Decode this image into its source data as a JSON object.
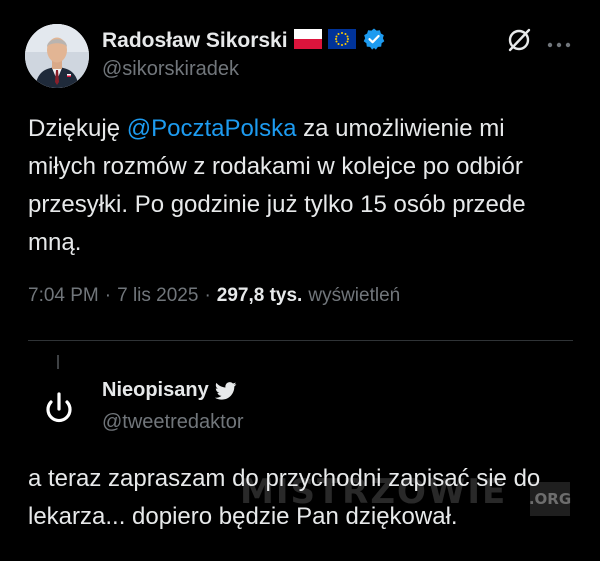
{
  "tweet": {
    "author": {
      "name": "Radosław Sikorski",
      "handle": "@sikorskiradek",
      "flags": [
        "poland-flag",
        "eu-flag"
      ],
      "verified": true
    },
    "text_before": "Dziękuję ",
    "mention": "@PocztaPolska",
    "text_after": " za umożliwienie mi miłych rozmów z rodakami w kolejce po odbiór przesyłki. Po godzinie już tylko 15 osób przede mną.",
    "time": "7:04 PM",
    "separator": "·",
    "date": "7 lis 2025",
    "views_count": "297,8 tys.",
    "views_label": "wyświetleń",
    "icons": {
      "grok": "grok-icon",
      "more": "more-options-icon"
    }
  },
  "reply": {
    "author": {
      "name": "Nieopisany",
      "handle": "@tweetredaktor",
      "badge": "twitter-bird-icon"
    },
    "text": "a teraz zapraszam do przychodni zapisać sie do lekarza... dopiero będzie Pan dziękował."
  },
  "watermark": {
    "text": "MISTRZOWIE",
    "suffix": ".ORG"
  },
  "colors": {
    "background": "#000000",
    "text": "#e7e9ea",
    "muted": "#71767b",
    "accent": "#1d9bf0",
    "divider": "#2f3336"
  }
}
